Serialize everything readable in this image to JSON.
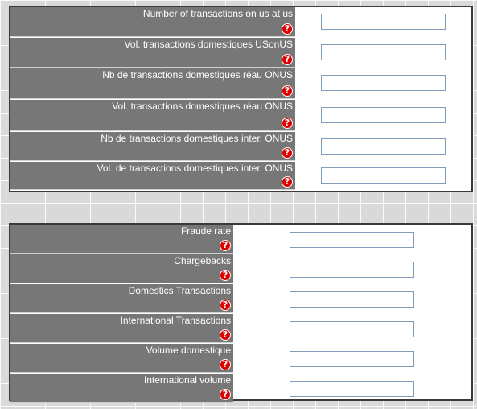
{
  "panels": [
    {
      "rows": [
        {
          "label": "Number of transactions on us at us",
          "value": "",
          "help": "?"
        },
        {
          "label": "Vol. transactions domestiques USonUS",
          "value": "",
          "help": "?"
        },
        {
          "label": "Nb de transactions domestiques réau ONUS",
          "value": "",
          "help": "?"
        },
        {
          "label": "Vol. transactions domestiques réau ONUS",
          "value": "",
          "help": "?"
        },
        {
          "label": "Nb de transactions domestiques inter. ONUS",
          "value": "",
          "help": "?"
        },
        {
          "label": "Vol. de transactions domestiques inter. ONUS",
          "value": "",
          "help": "?"
        }
      ]
    },
    {
      "rows": [
        {
          "label": "Fraude rate",
          "value": "",
          "help": "?"
        },
        {
          "label": "Chargebacks",
          "value": "",
          "help": "?"
        },
        {
          "label": "Domestics Transactions",
          "value": "",
          "help": "?"
        },
        {
          "label": "International Transactions",
          "value": "",
          "help": "?"
        },
        {
          "label": "Volume domestique",
          "value": "",
          "help": "?"
        },
        {
          "label": "International volume",
          "value": "",
          "help": "?"
        }
      ]
    }
  ],
  "colors": {
    "label_background": "#777777",
    "help_icon": "#dd0000",
    "field_border": "#7f9db9"
  },
  "icons": {
    "help": "help-icon"
  }
}
